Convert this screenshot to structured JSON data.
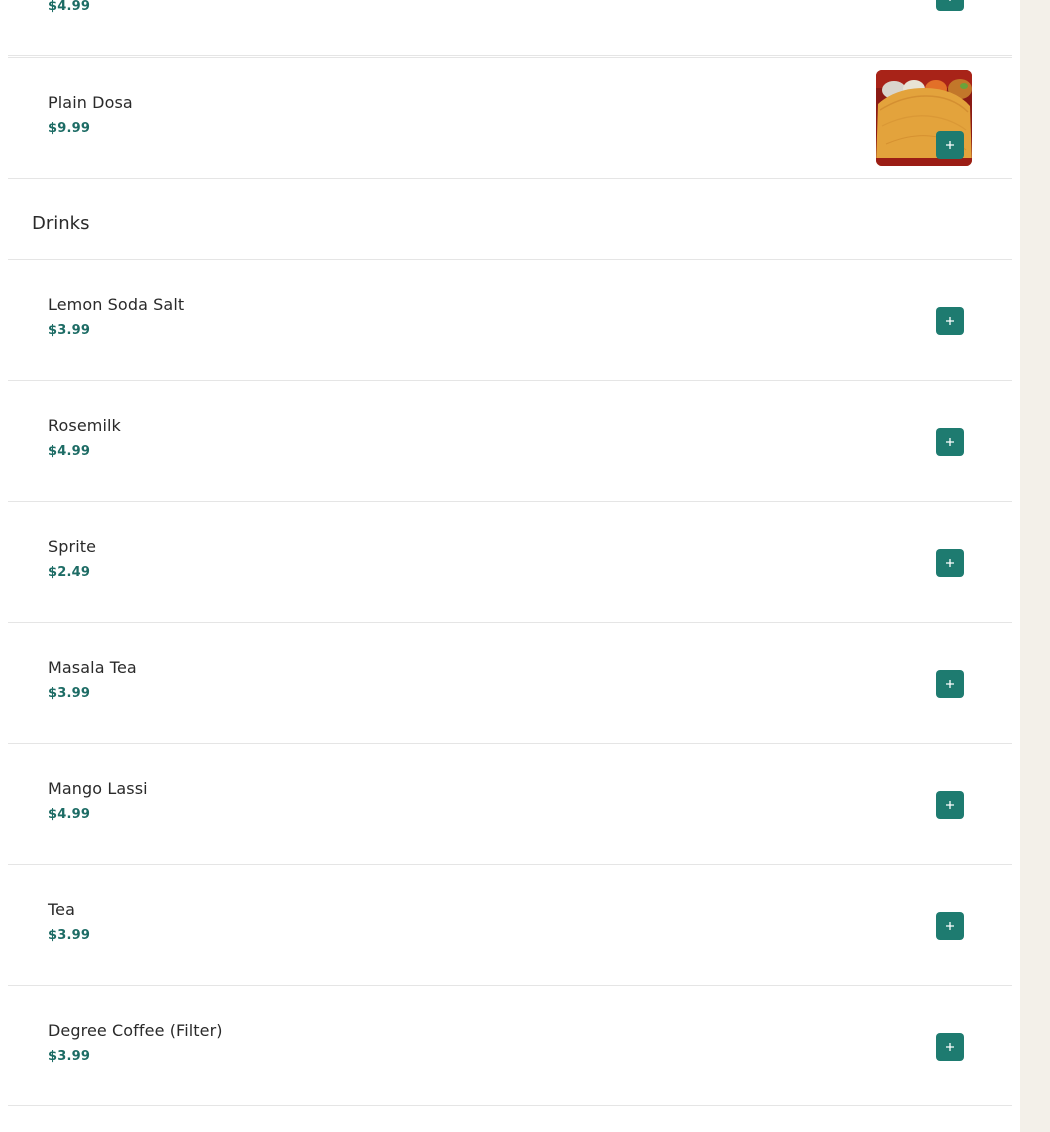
{
  "menu": {
    "previous_item": {
      "price": "$4.99"
    },
    "top_items": [
      {
        "name": "Plain Dosa",
        "price": "$9.99",
        "image": "plain-dosa-photo"
      }
    ],
    "categories": [
      {
        "title": "Drinks",
        "items": [
          {
            "name": "Lemon Soda Salt",
            "price": "$3.99"
          },
          {
            "name": "Rosemilk",
            "price": "$4.99"
          },
          {
            "name": "Sprite",
            "price": "$2.49"
          },
          {
            "name": "Masala Tea",
            "price": "$3.99"
          },
          {
            "name": "Mango Lassi",
            "price": "$4.99"
          },
          {
            "name": "Tea",
            "price": "$3.99"
          },
          {
            "name": "Degree Coffee (Filter)",
            "price": "$3.99"
          }
        ]
      }
    ],
    "icons": {
      "add": "plus-icon"
    },
    "colors": {
      "accent": "#1e7b70",
      "price": "#1d6c65",
      "sidebar_bg": "#f3f0e9"
    }
  }
}
